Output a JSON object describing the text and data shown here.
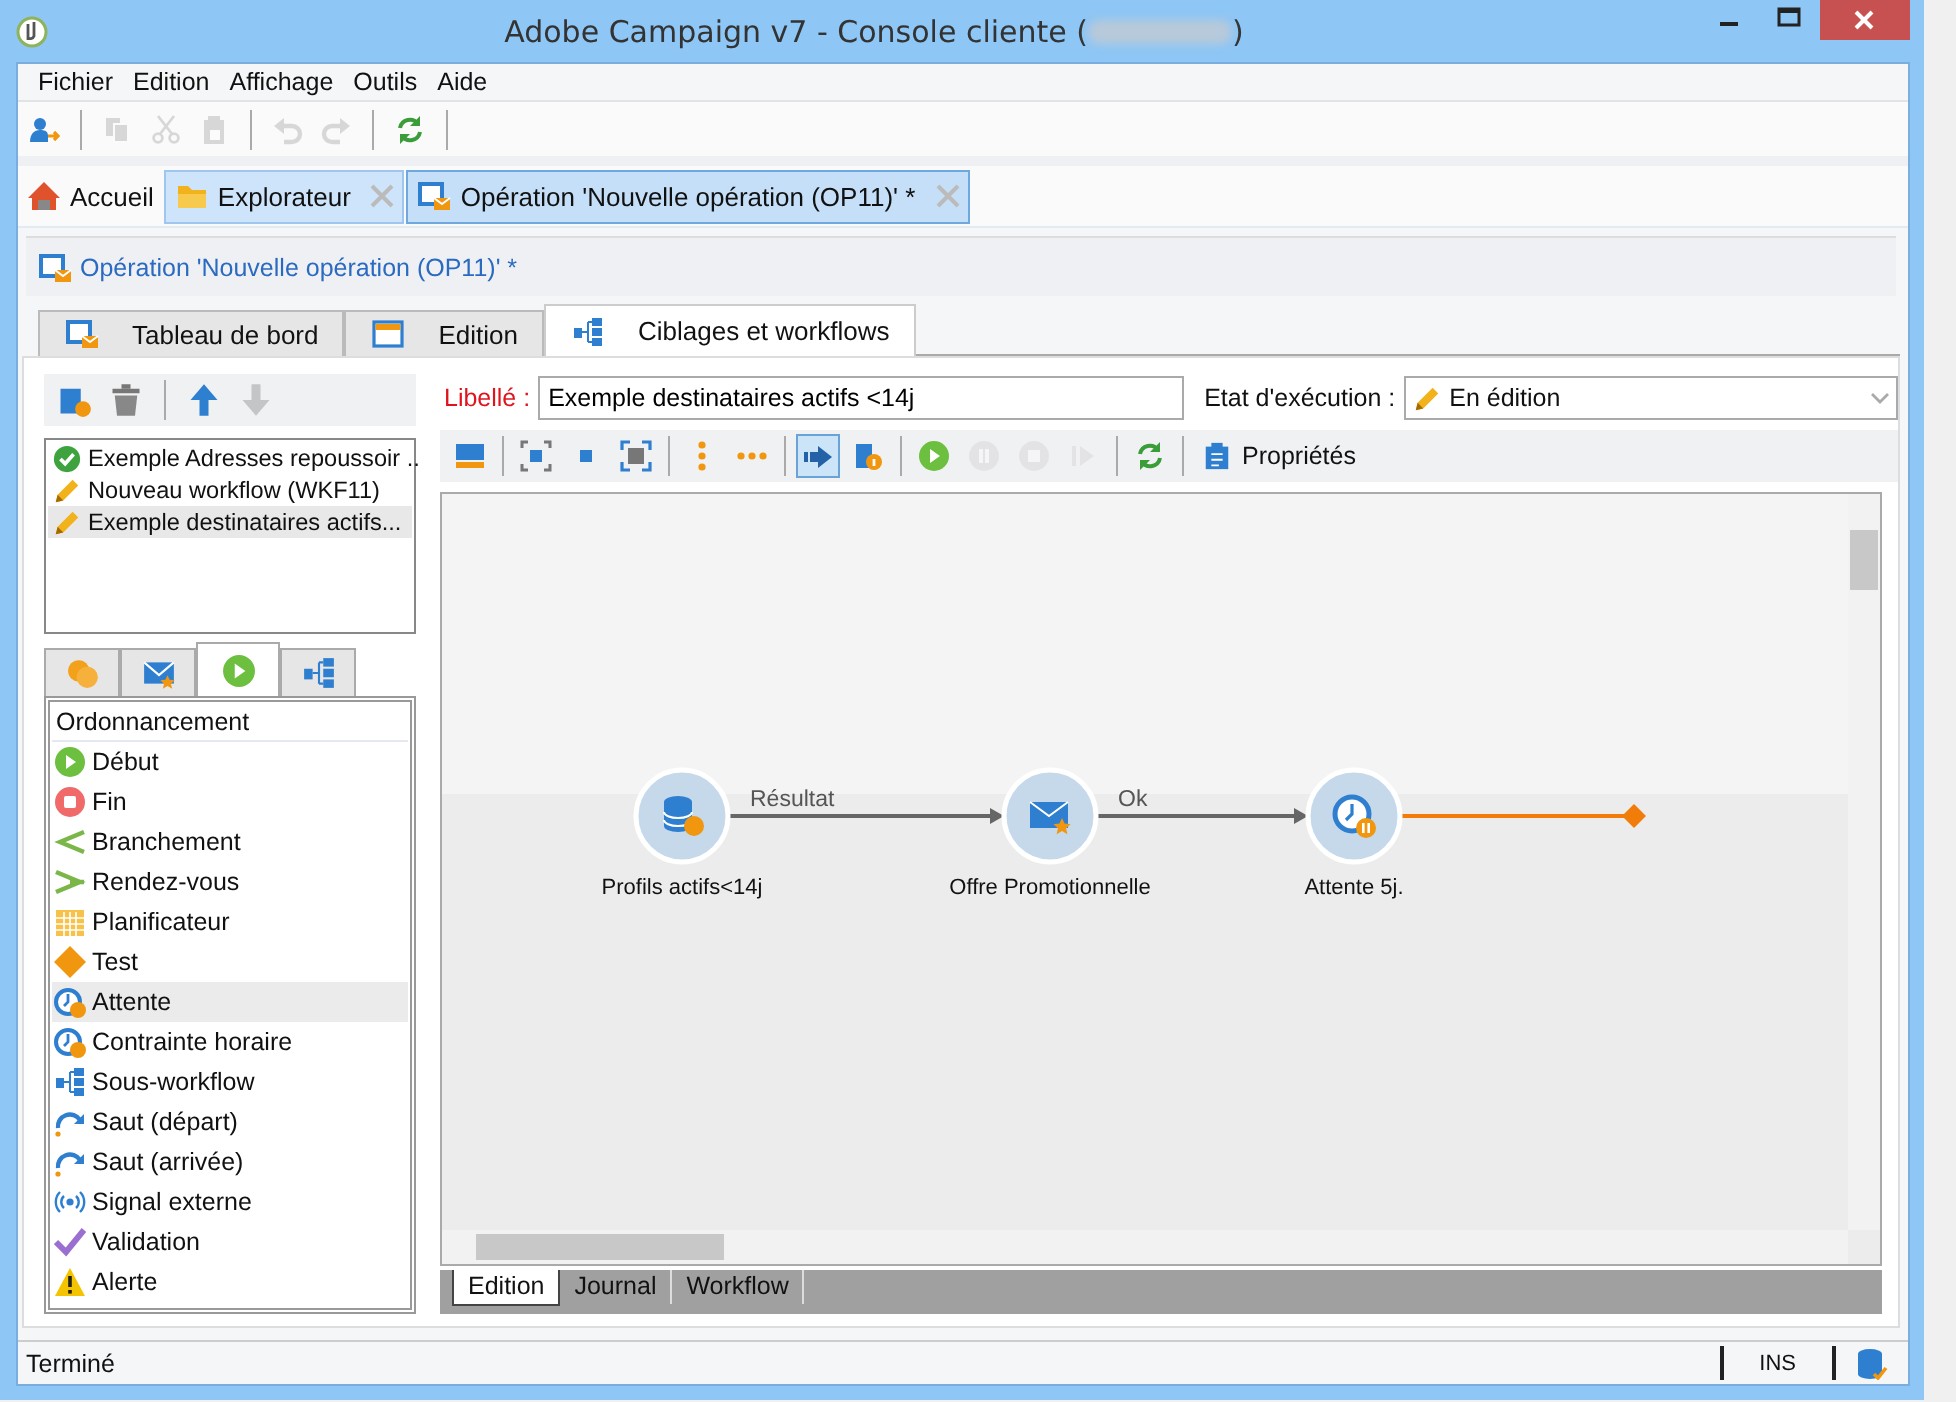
{
  "window": {
    "title_start": "Adobe Campaign v7 - Console cliente (",
    "title_end": ")",
    "redacted": true
  },
  "menu": [
    "Fichier",
    "Edition",
    "Affichage",
    "Outils",
    "Aide"
  ],
  "toolbar": [
    {
      "kind": "new-user",
      "disabled": false
    },
    {
      "kind": "sep"
    },
    {
      "kind": "copy",
      "disabled": true
    },
    {
      "kind": "cut",
      "disabled": true
    },
    {
      "kind": "paste",
      "disabled": true
    },
    {
      "kind": "sep"
    },
    {
      "kind": "undo",
      "disabled": true
    },
    {
      "kind": "redo",
      "disabled": true
    },
    {
      "kind": "sep"
    },
    {
      "kind": "refresh",
      "disabled": false
    },
    {
      "kind": "sep"
    }
  ],
  "doc_tabs": [
    {
      "kind": "home",
      "label": "Accueil",
      "selected": false,
      "closable": false
    },
    {
      "kind": "folder",
      "label": "Explorateur",
      "selected": false,
      "closable": true
    },
    {
      "kind": "operation",
      "label": "Opération 'Nouvelle opération (OP11)' *",
      "selected": true,
      "closable": true
    }
  ],
  "breadcrumb": "Opération 'Nouvelle opération (OP11)' *",
  "view_tabs": [
    {
      "kind": "operation",
      "label": "Tableau de bord",
      "selected": false
    },
    {
      "kind": "form",
      "label": "Edition",
      "selected": false
    },
    {
      "kind": "workflow",
      "label": "Ciblages et workflows",
      "selected": true
    }
  ],
  "list_toolbar": [
    {
      "kind": "new-workflow",
      "disabled": false
    },
    {
      "kind": "delete",
      "disabled": false
    },
    {
      "kind": "sep"
    },
    {
      "kind": "up",
      "disabled": false
    },
    {
      "kind": "down",
      "disabled": true
    }
  ],
  "workflows": [
    {
      "kind": "finished",
      "label": "Exemple Adresses repoussoir ..",
      "selected": false
    },
    {
      "kind": "editing",
      "label": "Nouveau workflow (WKF11)",
      "selected": false
    },
    {
      "kind": "editing",
      "label": "Exemple destinataires actifs...",
      "selected": true
    }
  ],
  "palette_tabs": [
    {
      "kind": "targeting",
      "selected": false
    },
    {
      "kind": "delivery",
      "selected": false
    },
    {
      "kind": "flow",
      "selected": true
    },
    {
      "kind": "subworkflow",
      "selected": false
    }
  ],
  "palette": {
    "header": "Ordonnancement",
    "items": [
      {
        "kind": "start",
        "label": "Début",
        "selected": false
      },
      {
        "kind": "end",
        "label": "Fin",
        "selected": false
      },
      {
        "kind": "fork",
        "label": "Branchement",
        "selected": false
      },
      {
        "kind": "join",
        "label": "Rendez-vous",
        "selected": false
      },
      {
        "kind": "scheduler",
        "label": "Planificateur",
        "selected": false
      },
      {
        "kind": "test",
        "label": "Test",
        "selected": false
      },
      {
        "kind": "wait",
        "label": "Attente",
        "selected": true
      },
      {
        "kind": "wait",
        "label": "Contrainte horaire",
        "selected": false
      },
      {
        "kind": "subworkflow",
        "label": "Sous-workflow",
        "selected": false
      },
      {
        "kind": "jump",
        "label": "Saut (départ)",
        "selected": false
      },
      {
        "kind": "jump",
        "label": "Saut (arrivée)",
        "selected": false
      },
      {
        "kind": "signal",
        "label": "Signal externe",
        "selected": false
      },
      {
        "kind": "validation",
        "label": "Validation",
        "selected": false
      },
      {
        "kind": "alert",
        "label": "Alerte",
        "selected": false
      }
    ]
  },
  "form": {
    "label_caption": "Libellé :",
    "label_value": "Exemple destinataires actifs <14j",
    "state_caption": "Etat d'exécution :",
    "state_value": "En édition"
  },
  "editor_toolbar": [
    {
      "kind": "layout",
      "disabled": false,
      "selected": false
    },
    {
      "kind": "sep"
    },
    {
      "kind": "fit",
      "disabled": false,
      "selected": false
    },
    {
      "kind": "zoom-small",
      "disabled": false,
      "selected": false
    },
    {
      "kind": "zoom-frame",
      "disabled": false,
      "selected": false
    },
    {
      "kind": "sep"
    },
    {
      "kind": "align-v",
      "disabled": false,
      "selected": false
    },
    {
      "kind": "align-h",
      "disabled": false,
      "selected": false
    },
    {
      "kind": "sep"
    },
    {
      "kind": "link",
      "disabled": false,
      "selected": true
    },
    {
      "kind": "info",
      "disabled": false,
      "selected": false
    },
    {
      "kind": "sep"
    },
    {
      "kind": "play",
      "disabled": false,
      "selected": false
    },
    {
      "kind": "pause",
      "disabled": true,
      "selected": false
    },
    {
      "kind": "stop",
      "disabled": true,
      "selected": false
    },
    {
      "kind": "step",
      "disabled": true,
      "selected": false
    },
    {
      "kind": "sep"
    },
    {
      "kind": "refresh",
      "disabled": false,
      "selected": false
    },
    {
      "kind": "sep"
    }
  ],
  "properties_button": "Propriétés",
  "diagram": {
    "nodes": [
      {
        "kind": "query",
        "label": "Profils actifs<14j",
        "dangling": false
      },
      {
        "kind": "delivery",
        "label": "Offre Promotionnelle",
        "dangling": false
      },
      {
        "kind": "wait",
        "label": "Attente 5j.",
        "dangling": true
      }
    ],
    "edges": [
      {
        "label": "Résultat"
      },
      {
        "label": "Ok"
      }
    ]
  },
  "bottom_tabs": [
    {
      "label": "Edition",
      "selected": true
    },
    {
      "label": "Journal",
      "selected": false
    },
    {
      "label": "Workflow",
      "selected": false
    }
  ],
  "status_bar": {
    "message": "Terminé",
    "mode": "INS"
  }
}
